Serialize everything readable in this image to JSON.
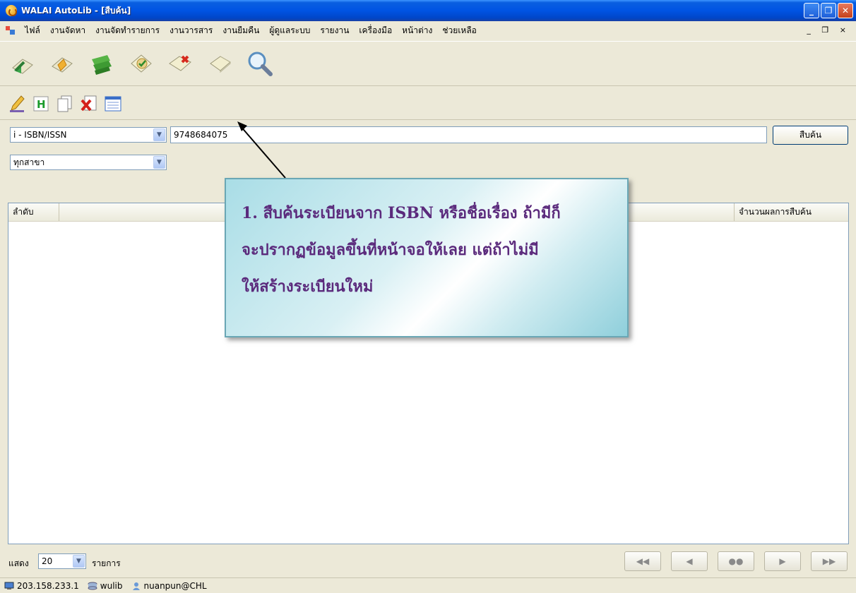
{
  "window": {
    "title": "WALAI AutoLib - [สืบค้น]",
    "controls": [
      "_",
      "❐",
      "✕"
    ]
  },
  "menu": {
    "items": [
      "ไฟล์",
      "งานจัดหา",
      "งานจัดทำรายการ",
      "งานวารสาร",
      "งานยืมคืน",
      "ผู้ดูแลระบบ",
      "รายงาน",
      "เครื่องมือ",
      "หน้าต่าง",
      "ช่วยเหลือ"
    ],
    "mdi_controls": "_ ❐ ×"
  },
  "toolbar_main": {
    "icons": [
      "acquisition-icon",
      "bookmark-icon",
      "money-icon",
      "check-badge-icon",
      "delete-badge-icon",
      "blank-doc-icon",
      "magnifier-icon"
    ]
  },
  "toolbar_sub": {
    "icons": [
      "edit-pencil-icon",
      "header-h-icon",
      "copy-pages-icon",
      "delete-x-icon",
      "list-view-icon"
    ]
  },
  "search": {
    "field_value": "i - ISBN/ISSN",
    "query": "9748684075",
    "branch_value": "ทุกสาขา",
    "button_label": "สืบค้น"
  },
  "results": {
    "col_order": "ลำดับ",
    "col_count": "จำนวนผลการสืบค้น"
  },
  "callout": {
    "line1": "1. สืบค้นระเบียนจาก ISBN หรือชื่อเรื่อง ถ้ามีก็",
    "line2": "จะปรากฏข้อมูลขึ้นที่หน้าจอให้เลย แต่ถ้าไม่มี",
    "line3": "ให้สร้างระเบียนใหม่"
  },
  "paging": {
    "label": "แสดง",
    "page_size": "20",
    "unit": "รายการ"
  },
  "status": {
    "ip": "203.158.233.1",
    "db": "wulib",
    "user": "nuanpun@CHL"
  }
}
